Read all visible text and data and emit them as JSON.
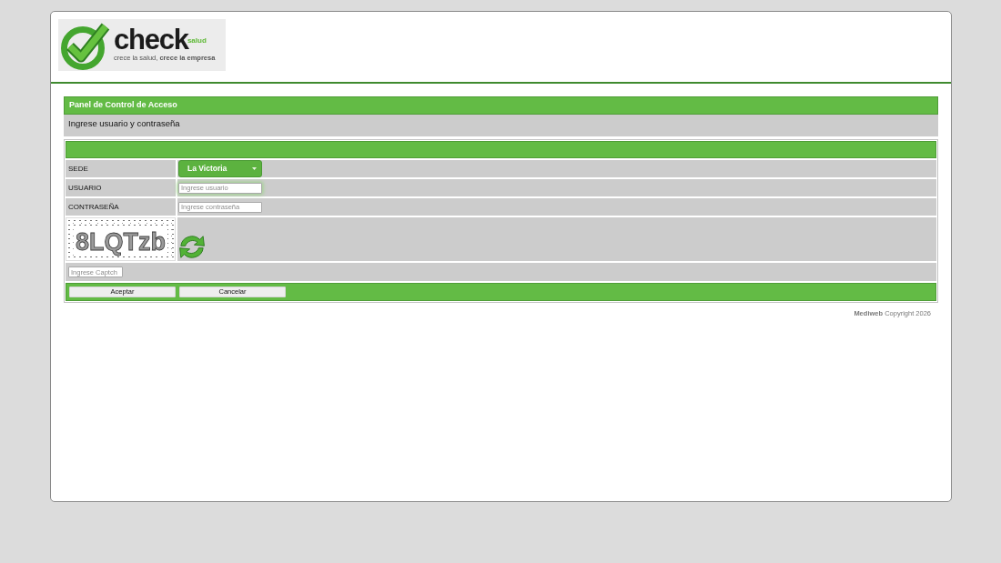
{
  "logo": {
    "brand": "check",
    "brand_suffix": "salud",
    "tagline": "crece la salud, **crece la empresa**"
  },
  "panel": {
    "title": "Panel de Control de Acceso",
    "subtitle": "Ingrese usuario y contraseña"
  },
  "form": {
    "fields": [
      {
        "kind": "select",
        "label": "SEDE",
        "value": "La Victoria"
      },
      {
        "kind": "text",
        "label": "USUARIO",
        "placeholder": "Ingrese usuario",
        "focused": true
      },
      {
        "kind": "password",
        "label": "CONTRASEÑA",
        "placeholder": "Ingrese contraseña",
        "focused": false
      },
      {
        "kind": "captcha",
        "captcha_text": "8LQTzb"
      },
      {
        "kind": "captcha_input",
        "placeholder": "Ingrese Captch"
      }
    ],
    "buttons": [
      "Aceptar",
      "Cancelar"
    ]
  },
  "footer": "**Mediweb** Copyright 2026"
}
